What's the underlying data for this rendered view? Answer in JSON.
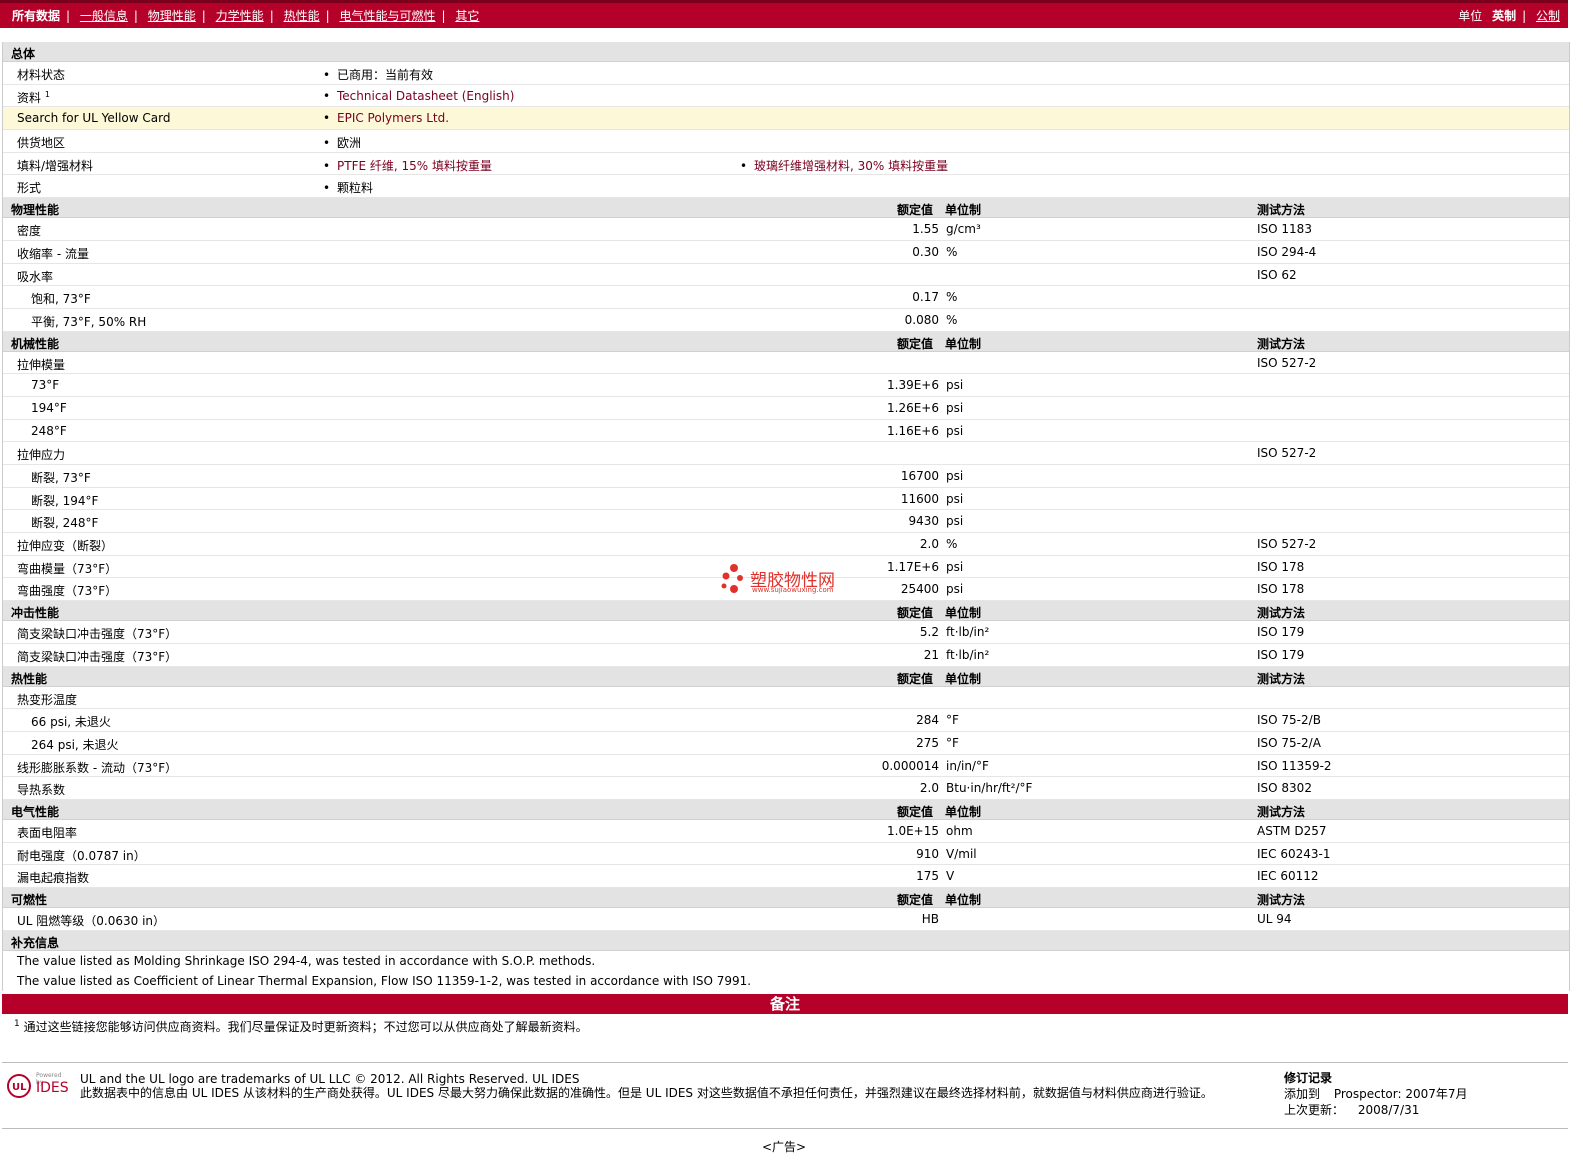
{
  "nav": {
    "items": [
      "所有数据",
      "一般信息",
      "物理性能",
      "力学性能",
      "热性能",
      "电气性能与可燃性",
      "其它"
    ],
    "units_label": "单位",
    "units_current": "英制",
    "units_alt": "公制"
  },
  "general": {
    "title": "总体",
    "rows": [
      {
        "name": "材料状态",
        "sup": "",
        "values": [
          "已商用：当前有效"
        ]
      },
      {
        "name": "资料",
        "sup": "1",
        "values": [
          "Technical Datasheet (English)"
        ]
      },
      {
        "name": "Search for UL Yellow Card",
        "sup": "",
        "values": [
          "EPIC Polymers Ltd."
        ]
      },
      {
        "name": "供货地区",
        "sup": "",
        "values": [
          "欧洲"
        ]
      },
      {
        "name": "填料/增强材料",
        "sup": "",
        "values": [
          "PTFE 纤维, 15% 填料按重量",
          "玻璃纤维增强材料, 30% 填料按重量"
        ]
      },
      {
        "name": "形式",
        "sup": "",
        "values": [
          "颗粒料"
        ]
      }
    ]
  },
  "headers": {
    "value": "额定值",
    "unit": "单位制",
    "method": "测试方法"
  },
  "sections": [
    {
      "title": "物理性能",
      "rows": [
        {
          "name": "密度",
          "value": "1.55",
          "unit": "g/cm³",
          "method": "ISO 1183",
          "indent": false
        },
        {
          "name": "收缩率 - 流量",
          "value": "0.30",
          "unit": "%",
          "method": "ISO 294-4",
          "indent": false
        },
        {
          "name": "吸水率",
          "value": "",
          "unit": "",
          "method": "ISO 62",
          "indent": false
        },
        {
          "name": "饱和, 73°F",
          "value": "0.17",
          "unit": "%",
          "method": "",
          "indent": true
        },
        {
          "name": "平衡, 73°F, 50% RH",
          "value": "0.080",
          "unit": "%",
          "method": "",
          "indent": true
        }
      ]
    },
    {
      "title": "机械性能",
      "rows": [
        {
          "name": "拉伸模量",
          "value": "",
          "unit": "",
          "method": "ISO 527-2",
          "indent": false
        },
        {
          "name": "73°F",
          "value": "1.39E+6",
          "unit": "psi",
          "method": "",
          "indent": true
        },
        {
          "name": "194°F",
          "value": "1.26E+6",
          "unit": "psi",
          "method": "",
          "indent": true
        },
        {
          "name": "248°F",
          "value": "1.16E+6",
          "unit": "psi",
          "method": "",
          "indent": true
        },
        {
          "name": "拉伸应力",
          "value": "",
          "unit": "",
          "method": "ISO 527-2",
          "indent": false
        },
        {
          "name": "断裂, 73°F",
          "value": "16700",
          "unit": "psi",
          "method": "",
          "indent": true
        },
        {
          "name": "断裂, 194°F",
          "value": "11600",
          "unit": "psi",
          "method": "",
          "indent": true
        },
        {
          "name": "断裂, 248°F",
          "value": "9430",
          "unit": "psi",
          "method": "",
          "indent": true
        },
        {
          "name": "拉伸应变（断裂）",
          "value": "2.0",
          "unit": "%",
          "method": "ISO 527-2",
          "indent": false
        },
        {
          "name": "弯曲模量（73°F）",
          "value": "1.17E+6",
          "unit": "psi",
          "method": "ISO 178",
          "indent": false
        },
        {
          "name": "弯曲强度（73°F）",
          "value": "25400",
          "unit": "psi",
          "method": "ISO 178",
          "indent": false
        }
      ]
    },
    {
      "title": "冲击性能",
      "rows": [
        {
          "name": "简支梁缺口冲击强度（73°F）",
          "value": "5.2",
          "unit": "ft·lb/in²",
          "method": "ISO 179",
          "indent": false
        },
        {
          "name": "简支梁缺口冲击强度（73°F）",
          "value": "21",
          "unit": "ft·lb/in²",
          "method": "ISO 179",
          "indent": false
        }
      ]
    },
    {
      "title": "热性能",
      "rows": [
        {
          "name": "热变形温度",
          "value": "",
          "unit": "",
          "method": "",
          "indent": false
        },
        {
          "name": "66 psi, 未退火",
          "value": "284",
          "unit": "°F",
          "method": "ISO 75-2/B",
          "indent": true
        },
        {
          "name": "264 psi, 未退火",
          "value": "275",
          "unit": "°F",
          "method": "ISO 75-2/A",
          "indent": true
        },
        {
          "name": "线形膨胀系数 - 流动（73°F）",
          "value": "0.000014",
          "unit": "in/in/°F",
          "method": "ISO 11359-2",
          "indent": false
        },
        {
          "name": "导热系数",
          "value": "2.0",
          "unit": "Btu·in/hr/ft²/°F",
          "method": "ISO 8302",
          "indent": false
        }
      ]
    },
    {
      "title": "电气性能",
      "rows": [
        {
          "name": "表面电阻率",
          "value": "1.0E+15",
          "unit": "ohm",
          "method": "ASTM D257",
          "indent": false
        },
        {
          "name": "耐电强度（0.0787 in）",
          "value": "910",
          "unit": "V/mil",
          "method": "IEC 60243-1",
          "indent": false
        },
        {
          "name": "漏电起痕指数",
          "value": "175",
          "unit": "V",
          "method": "IEC 60112",
          "indent": false
        }
      ]
    },
    {
      "title": "可燃性",
      "rows": [
        {
          "name": "UL 阻燃等级（0.0630 in）",
          "value": "HB",
          "unit": "",
          "method": "UL 94",
          "indent": false
        }
      ]
    }
  ],
  "supplement": {
    "title": "补充信息",
    "notes": [
      "The value listed as Molding Shrinkage ISO 294-4, was tested in accordance with S.O.P. methods.",
      "The value listed as Coefficient of Linear Thermal Expansion, Flow ISO 11359-1-2, was tested in accordance with ISO 7991."
    ]
  },
  "remarks": {
    "title": "备注",
    "sup": "1",
    "text": "通过这些链接您能够访问供应商资料。我们尽量保证及时更新资料；不过您可以从供应商处了解最新资料。"
  },
  "footer": {
    "logo_text": "IDES",
    "logo_small": "Powered by",
    "line1": "UL and the UL logo are trademarks of UL LLC © 2012. All Rights Reserved. UL IDES",
    "line2": "此数据表中的信息由 UL IDES 从该材料的生产商处获得。UL IDES 尽最大努力确保此数据的准确性。但是 UL IDES 对这些数据值不承担任何责任，并强烈建议在最终选择材料前，就数据值与材料供应商进行验证。",
    "revision_title": "修订记录",
    "added_label": "添加到",
    "added_value": "Prospector: 2007年7月",
    "updated_label": "上次更新：",
    "updated_value": "2008/7/31"
  },
  "ad": "<广告>",
  "watermark": {
    "text": "塑胶物性网",
    "sub": "www.sujiaowuxing.com"
  }
}
